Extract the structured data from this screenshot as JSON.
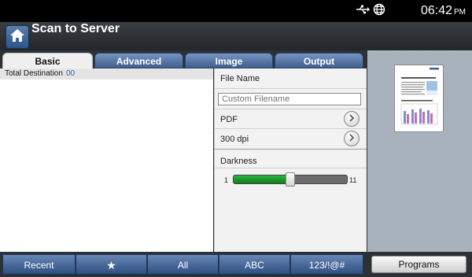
{
  "status_bar": {
    "time": "06:42",
    "ampm": "PM",
    "icons": [
      "usb-icon",
      "network-globe-icon"
    ]
  },
  "header": {
    "title": "Scan to Server"
  },
  "tabs": [
    {
      "label": "Basic",
      "active": true
    },
    {
      "label": "Advanced",
      "active": false
    },
    {
      "label": "Image",
      "active": false
    },
    {
      "label": "Output",
      "active": false
    }
  ],
  "destination": {
    "label": "Total Destination",
    "count": "00"
  },
  "settings": {
    "file_name_label": "File Name",
    "filename_placeholder": "Custom Filename",
    "format_value": "PDF",
    "resolution_value": "300 dpi",
    "darkness_label": "Darkness",
    "darkness_min": "1",
    "darkness_max": "11",
    "darkness_level": 6
  },
  "bottom_bar": {
    "buttons": [
      "Recent",
      "★",
      "All",
      "ABC",
      "123/!@#"
    ],
    "programs_label": "Programs"
  },
  "colors": {
    "accent_blue": "#3f5f8e",
    "slider_green": "#1a9a2c"
  }
}
